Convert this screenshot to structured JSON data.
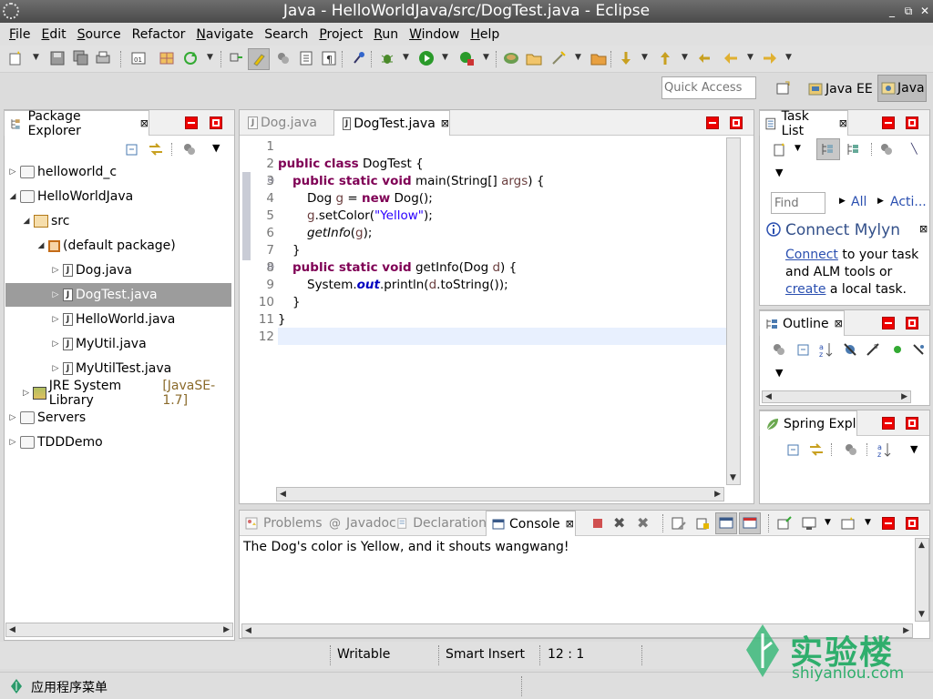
{
  "window": {
    "title": "Java - HelloWorldJava/src/DogTest.java - Eclipse"
  },
  "menu": [
    {
      "label": "File",
      "u": "F",
      "rest": "ile"
    },
    {
      "label": "Edit",
      "u": "E",
      "rest": "dit"
    },
    {
      "label": "Source",
      "u": "S",
      "rest": "ource"
    },
    {
      "label": "Refactor",
      "u": "",
      "rest": "Refactor"
    },
    {
      "label": "Navigate",
      "u": "N",
      "rest": "avigate"
    },
    {
      "label": "Search",
      "u": "",
      "rest": "Search"
    },
    {
      "label": "Project",
      "u": "P",
      "rest": "roject"
    },
    {
      "label": "Run",
      "u": "R",
      "rest": "un"
    },
    {
      "label": "Window",
      "u": "W",
      "rest": "indow"
    },
    {
      "label": "Help",
      "u": "H",
      "rest": "elp"
    }
  ],
  "quick_access": {
    "placeholder": "Quick Access"
  },
  "perspectives": {
    "java_ee": "Java EE",
    "java": "Java"
  },
  "package_explorer": {
    "tab_label": "Package Explorer",
    "tree": [
      {
        "label": "helloworld_c",
        "suffix": ""
      },
      {
        "label": "HelloWorldJava",
        "suffix": ""
      },
      {
        "label": "src",
        "suffix": ""
      },
      {
        "label": "(default package)",
        "suffix": ""
      },
      {
        "label": "Dog.java",
        "suffix": ""
      },
      {
        "label": "DogTest.java",
        "suffix": ""
      },
      {
        "label": "HelloWorld.java",
        "suffix": ""
      },
      {
        "label": "MyUtil.java",
        "suffix": ""
      },
      {
        "label": "MyUtilTest.java",
        "suffix": ""
      },
      {
        "label": "JRE System Library",
        "suffix": "[JavaSE-1.7]"
      },
      {
        "label": "Servers",
        "suffix": ""
      },
      {
        "label": "TDDDemo",
        "suffix": ""
      }
    ]
  },
  "editor": {
    "tabs": [
      "Dog.java",
      "DogTest.java"
    ],
    "line_numbers": [
      "1",
      "2",
      "3",
      "4",
      "5",
      "6",
      "7",
      "8",
      "9",
      "10",
      "11",
      "12"
    ],
    "code": {
      "l2_kw": "public class",
      "l2_rest": " DogTest {",
      "l3_kw": "public static void",
      "l3_a": " main(String[] ",
      "l3_var": "args",
      "l3_b": ") {",
      "l4_a": "Dog ",
      "l4_var": "g",
      "l4_b": " = ",
      "l4_kw": "new",
      "l4_c": " Dog();",
      "l5_var": "g",
      "l5_a": ".setColor(",
      "l5_str": "\"Yellow\"",
      "l5_b": ");",
      "l6_ital": "getInfo",
      "l6_a": "(",
      "l6_var": "g",
      "l6_b": ");",
      "l7": "}",
      "l8_kw": "public static void",
      "l8_a": " getInfo(Dog ",
      "l8_var": "d",
      "l8_b": ") {",
      "l9_a": "System.",
      "l9_fld": "out",
      "l9_b": ".println(",
      "l9_var": "d",
      "l9_c": ".toString());",
      "l10": "}",
      "l11": "}"
    }
  },
  "task_list": {
    "tab_label": "Task List",
    "find_placeholder": "Find",
    "all": "All",
    "activate": "Acti...",
    "connect_title": "Connect Mylyn",
    "connect_link": "Connect",
    "connect_text1": " to your task and ALM tools or ",
    "create_link": "create",
    "connect_text2": " a local task."
  },
  "outline": {
    "tab_label": "Outline"
  },
  "spring": {
    "tab_label": "Spring Expl"
  },
  "bottom_tabs": [
    "Problems",
    "Javadoc",
    "Declaration",
    "Console"
  ],
  "console": {
    "output": "The Dog's color is Yellow, and it shouts wangwang!"
  },
  "status": {
    "writable": "Writable",
    "insert_mode": "Smart Insert",
    "position": "12 : 1"
  },
  "taskbar": {
    "menu": "应用程序菜单"
  },
  "watermark": {
    "cn": "实验楼",
    "url": "shiyanlou.com"
  }
}
